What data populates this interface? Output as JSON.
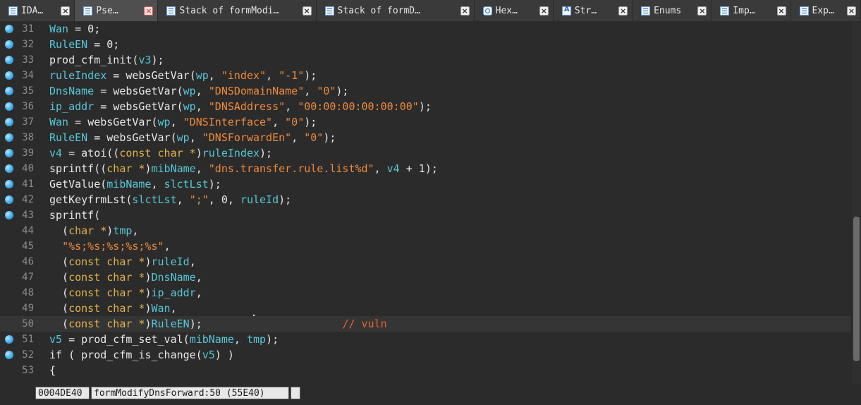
{
  "tabs": [
    {
      "label": "IDA…",
      "icon": "document-icon",
      "active": false
    },
    {
      "label": "Pse…",
      "icon": "document-icon",
      "active": true
    },
    {
      "label": "Stack of formModi…",
      "icon": "document-icon",
      "active": false
    },
    {
      "label": "Stack of formD…",
      "icon": "document-icon",
      "active": false
    },
    {
      "label": "Hex…",
      "icon": "hex-icon",
      "active": false
    },
    {
      "label": "Str…",
      "icon": "strings-icon",
      "active": false
    },
    {
      "label": "Enums",
      "icon": "document-icon",
      "active": false
    },
    {
      "label": "Imp…",
      "icon": "import-icon",
      "active": false
    },
    {
      "label": "Exp…",
      "icon": "export-icon",
      "active": false
    }
  ],
  "lines": [
    {
      "num": "31",
      "bp": true,
      "tokens": [
        [
          "var",
          "Wan"
        ],
        [
          "p",
          " = 0;"
        ]
      ]
    },
    {
      "num": "32",
      "bp": true,
      "tokens": [
        [
          "var",
          "RuleEN"
        ],
        [
          "p",
          " = 0;"
        ]
      ]
    },
    {
      "num": "33",
      "bp": true,
      "tokens": [
        [
          "fn",
          "prod_cfm_init"
        ],
        [
          "p",
          "("
        ],
        [
          "var",
          "v3"
        ],
        [
          "p",
          ");"
        ]
      ]
    },
    {
      "num": "34",
      "bp": true,
      "tokens": [
        [
          "var",
          "ruleIndex"
        ],
        [
          "p",
          " = "
        ],
        [
          "fn",
          "websGetVar"
        ],
        [
          "p",
          "("
        ],
        [
          "var",
          "wp"
        ],
        [
          "p",
          ", "
        ],
        [
          "str",
          "\"index\""
        ],
        [
          "p",
          ", "
        ],
        [
          "str",
          "\"-1\""
        ],
        [
          "p",
          ");"
        ]
      ]
    },
    {
      "num": "35",
      "bp": true,
      "tokens": [
        [
          "var",
          "DnsName"
        ],
        [
          "p",
          " = "
        ],
        [
          "fn",
          "websGetVar"
        ],
        [
          "p",
          "("
        ],
        [
          "var",
          "wp"
        ],
        [
          "p",
          ", "
        ],
        [
          "str",
          "\"DNSDomainName\""
        ],
        [
          "p",
          ", "
        ],
        [
          "str",
          "\"0\""
        ],
        [
          "p",
          ");"
        ]
      ]
    },
    {
      "num": "36",
      "bp": true,
      "tokens": [
        [
          "var",
          "ip_addr"
        ],
        [
          "p",
          " = "
        ],
        [
          "fn",
          "websGetVar"
        ],
        [
          "p",
          "("
        ],
        [
          "var",
          "wp"
        ],
        [
          "p",
          ", "
        ],
        [
          "str",
          "\"DNSAddress\""
        ],
        [
          "p",
          ", "
        ],
        [
          "str",
          "\"00:00:00:00:00:00\""
        ],
        [
          "p",
          ");"
        ]
      ]
    },
    {
      "num": "37",
      "bp": true,
      "tokens": [
        [
          "var",
          "Wan"
        ],
        [
          "p",
          " = "
        ],
        [
          "fn",
          "websGetVar"
        ],
        [
          "p",
          "("
        ],
        [
          "var",
          "wp"
        ],
        [
          "p",
          ", "
        ],
        [
          "str",
          "\"DNSInterface\""
        ],
        [
          "p",
          ", "
        ],
        [
          "str",
          "\"0\""
        ],
        [
          "p",
          ");"
        ]
      ]
    },
    {
      "num": "38",
      "bp": true,
      "tokens": [
        [
          "var",
          "RuleEN"
        ],
        [
          "p",
          " = "
        ],
        [
          "fn",
          "websGetVar"
        ],
        [
          "p",
          "("
        ],
        [
          "var",
          "wp"
        ],
        [
          "p",
          ", "
        ],
        [
          "str",
          "\"DNSForwardEn\""
        ],
        [
          "p",
          ", "
        ],
        [
          "str",
          "\"0\""
        ],
        [
          "p",
          ");"
        ]
      ]
    },
    {
      "num": "39",
      "bp": true,
      "tokens": [
        [
          "var",
          "v4"
        ],
        [
          "p",
          " = "
        ],
        [
          "fn",
          "atoi"
        ],
        [
          "p",
          "(("
        ],
        [
          "kw",
          "const char *"
        ],
        [
          "p",
          ")"
        ],
        [
          "var",
          "ruleIndex"
        ],
        [
          "p",
          ");"
        ]
      ]
    },
    {
      "num": "40",
      "bp": true,
      "tokens": [
        [
          "fn",
          "sprintf"
        ],
        [
          "p",
          "(("
        ],
        [
          "kw",
          "char *"
        ],
        [
          "p",
          ")"
        ],
        [
          "var",
          "mibName"
        ],
        [
          "p",
          ", "
        ],
        [
          "str",
          "\"dns.transfer.rule.list%d\""
        ],
        [
          "p",
          ", "
        ],
        [
          "var",
          "v4"
        ],
        [
          "p",
          " + 1);"
        ]
      ]
    },
    {
      "num": "41",
      "bp": true,
      "tokens": [
        [
          "fn",
          "GetValue"
        ],
        [
          "p",
          "("
        ],
        [
          "var",
          "mibName"
        ],
        [
          "p",
          ", "
        ],
        [
          "var",
          "slctLst"
        ],
        [
          "p",
          ");"
        ]
      ]
    },
    {
      "num": "42",
      "bp": true,
      "tokens": [
        [
          "fn",
          "getKeyfrmLst"
        ],
        [
          "p",
          "("
        ],
        [
          "var",
          "slctLst"
        ],
        [
          "p",
          ", "
        ],
        [
          "str",
          "\";\""
        ],
        [
          "p",
          ", 0, "
        ],
        [
          "var",
          "ruleId"
        ],
        [
          "p",
          ");"
        ]
      ]
    },
    {
      "num": "43",
      "bp": true,
      "tokens": [
        [
          "fn",
          "sprintf"
        ],
        [
          "p",
          "("
        ]
      ]
    },
    {
      "num": "44",
      "bp": false,
      "tokens": [
        [
          "p",
          "  ("
        ],
        [
          "kw",
          "char *"
        ],
        [
          "p",
          ")"
        ],
        [
          "var",
          "tmp"
        ],
        [
          "p",
          ","
        ]
      ]
    },
    {
      "num": "45",
      "bp": false,
      "tokens": [
        [
          "p",
          "  "
        ],
        [
          "str",
          "\"%s;%s;%s;%s;%s\""
        ],
        [
          "p",
          ","
        ]
      ]
    },
    {
      "num": "46",
      "bp": false,
      "tokens": [
        [
          "p",
          "  ("
        ],
        [
          "kw",
          "const char *"
        ],
        [
          "p",
          ")"
        ],
        [
          "var",
          "ruleId"
        ],
        [
          "p",
          ","
        ]
      ]
    },
    {
      "num": "47",
      "bp": false,
      "tokens": [
        [
          "p",
          "  ("
        ],
        [
          "kw",
          "const char *"
        ],
        [
          "p",
          ")"
        ],
        [
          "var",
          "DnsName"
        ],
        [
          "p",
          ","
        ]
      ]
    },
    {
      "num": "48",
      "bp": false,
      "tokens": [
        [
          "p",
          "  ("
        ],
        [
          "kw",
          "const char *"
        ],
        [
          "p",
          ")"
        ],
        [
          "var",
          "ip_addr"
        ],
        [
          "p",
          ","
        ]
      ]
    },
    {
      "num": "49",
      "bp": false,
      "tokens": [
        [
          "p",
          "  ("
        ],
        [
          "kw",
          "const char *"
        ],
        [
          "p",
          ")"
        ],
        [
          "var",
          "Wan"
        ],
        [
          "p",
          ","
        ]
      ]
    },
    {
      "num": "50",
      "bp": false,
      "current": true,
      "tokens": [
        [
          "p",
          "  ("
        ],
        [
          "kw",
          "const char *"
        ],
        [
          "p",
          ")"
        ],
        [
          "var",
          "RuleEN"
        ],
        [
          "p",
          ");                      "
        ],
        [
          "cm",
          "// vuln"
        ]
      ]
    },
    {
      "num": "51",
      "bp": true,
      "tokens": [
        [
          "var",
          "v5"
        ],
        [
          "p",
          " = "
        ],
        [
          "fn",
          "prod_cfm_set_val"
        ],
        [
          "p",
          "("
        ],
        [
          "var",
          "mibName"
        ],
        [
          "p",
          ", "
        ],
        [
          "var",
          "tmp"
        ],
        [
          "p",
          ");"
        ]
      ]
    },
    {
      "num": "52",
      "bp": true,
      "tokens": [
        [
          "p",
          "if ( "
        ],
        [
          "fn",
          "prod_cfm_is_change"
        ],
        [
          "p",
          "("
        ],
        [
          "var",
          "v5"
        ],
        [
          "p",
          ") )"
        ]
      ]
    },
    {
      "num": "53",
      "bp": false,
      "tokens": [
        [
          "p",
          "{"
        ]
      ]
    }
  ],
  "status": {
    "address": "0004DE40",
    "location": "formModifyDnsForward:50 (55E40)"
  }
}
